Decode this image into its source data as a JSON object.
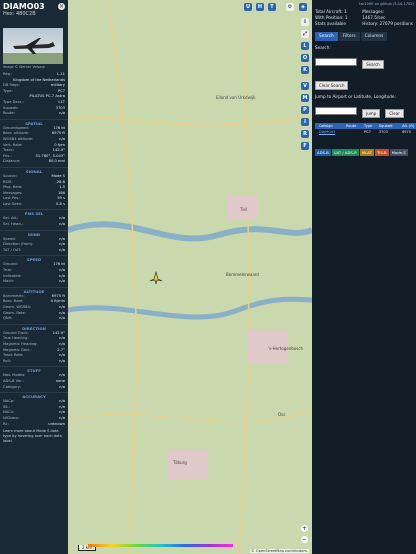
{
  "aircraft": {
    "callsign": "DIAMO03",
    "hex_line": "Hex: 480C2B",
    "image_credit": "Image © Werner Velsaqt",
    "details": [
      {
        "k": "Reg.:",
        "v": "L-11"
      },
      {
        "k": "",
        "v": "Kingdom of the Netherlands"
      },
      {
        "k": "DB flags:",
        "v": "military"
      },
      {
        "k": "Type:",
        "v": "PC7"
      },
      {
        "k": "",
        "v": "PILATUS PC-7 Astra"
      },
      {
        "k": "Type Desc.:",
        "v": "L1T"
      },
      {
        "k": "Squawk:",
        "v": "3703"
      },
      {
        "k": "Route:",
        "v": "n/a"
      }
    ],
    "sections": [
      {
        "title": "SPATIAL",
        "rows": [
          {
            "k": "Groundspeed:",
            "v": "176 kt"
          },
          {
            "k": "Baro. altitude:",
            "v": "6975 ft"
          },
          {
            "k": "WGS84 altitude:",
            "v": "n/a"
          },
          {
            "k": "Vert. Rate:",
            "v": "0 fpm"
          },
          {
            "k": "Track:",
            "v": "142.0°"
          },
          {
            "k": "Pos.:",
            "v": "51.780°, 5.043°"
          },
          {
            "k": "Distance:",
            "v": "80.0 nmi"
          }
        ]
      },
      {
        "title": "SIGNAL",
        "rows": [
          {
            "k": "Source:",
            "v": "Mode S"
          },
          {
            "k": "RSSI:",
            "v": "-28.6"
          },
          {
            "k": "Msg. Rate:",
            "v": "1.5"
          },
          {
            "k": "Messages:",
            "v": "186"
          },
          {
            "k": "Last Pos.:",
            "v": "59 s"
          },
          {
            "k": "Last Seen:",
            "v": "0.8 s"
          }
        ]
      },
      {
        "title": "FMS SEL",
        "rows": [
          {
            "k": "Sel. Alt.:",
            "v": "n/a"
          },
          {
            "k": "Sel. Head.:",
            "v": "n/a"
          }
        ]
      },
      {
        "title": "WIND",
        "rows": [
          {
            "k": "Speed:",
            "v": "n/a"
          },
          {
            "k": "Direction (from):",
            "v": "n/a"
          },
          {
            "k": "TAT / OAT:",
            "v": "n/a"
          }
        ]
      },
      {
        "title": "SPEED",
        "rows": [
          {
            "k": "Ground:",
            "v": "176 kt"
          },
          {
            "k": "True:",
            "v": "n/a"
          },
          {
            "k": "Indicated:",
            "v": "n/a"
          },
          {
            "k": "Mach:",
            "v": "n/a"
          }
        ]
      },
      {
        "title": "ALTITUDE",
        "rows": [
          {
            "k": "Barometric:",
            "v": "6975 ft"
          },
          {
            "k": "Baro. Rate:",
            "v": "0 ft/min"
          },
          {
            "k": "Geom. WGS84:",
            "v": "n/a"
          },
          {
            "k": "Geom. Rate:",
            "v": "n/a"
          },
          {
            "k": "QNH:",
            "v": "n/a"
          }
        ]
      },
      {
        "title": "DIRECTION",
        "rows": [
          {
            "k": "Ground Track:",
            "v": "142.0°"
          },
          {
            "k": "True Heading:",
            "v": "n/a"
          },
          {
            "k": "Magnetic Heading:",
            "v": "n/a"
          },
          {
            "k": "Magnetic Decl.:",
            "v": "2.7°"
          },
          {
            "k": "Track Rate:",
            "v": "n/a"
          },
          {
            "k": "Roll:",
            "v": "n/a"
          }
        ]
      },
      {
        "title": "STUFF",
        "rows": [
          {
            "k": "Nav. Modes:",
            "v": "n/a"
          },
          {
            "k": "ADS-B Ver.:",
            "v": "none"
          },
          {
            "k": "Category:",
            "v": "n/a"
          }
        ]
      },
      {
        "title": "ACCURACY",
        "rows": [
          {
            "k": "NACp:",
            "v": "n/a"
          },
          {
            "k": "SIL:",
            "v": "n/a"
          },
          {
            "k": "NACv:",
            "v": "n/a"
          },
          {
            "k": "NICbaro:",
            "v": "n/a"
          },
          {
            "k": "Rc:",
            "v": "unknown"
          }
        ]
      }
    ],
    "learn_more": "Learn more about Mode S data type by hovering over each data label."
  },
  "map": {
    "top_buttons": [
      "U",
      "H",
      "T"
    ],
    "side_buttons": [
      "L",
      "O",
      "K",
      "V",
      "M",
      "P",
      "I",
      "R",
      "F"
    ],
    "places": [
      {
        "label": "Eiland van Urkdwijk"
      },
      {
        "label": "Tiel"
      },
      {
        "label": "Bommelerwaard"
      },
      {
        "label": "'s-Hertogenbosch"
      },
      {
        "label": "Tilburg"
      },
      {
        "label": "Oss"
      }
    ],
    "scale": "2 km",
    "attribution": "© OpenStreetMap contributors.",
    "zoom_in": "+",
    "zoom_out": "−"
  },
  "right": {
    "version_link": "tar1090 on github (3.14.1702)",
    "total_label": "Total Aircraft: 1",
    "messages_label": "Messages:",
    "messages_value": "1467.5/sec",
    "position_label": "With Position: 1",
    "history_label": "History: 27079 positions",
    "stats_label": "Stats available",
    "tabs": [
      "Search",
      "Filters",
      "Columns"
    ],
    "search_label": "Search:",
    "search_button": "Search",
    "clear_button": "Clear Search",
    "jump_label": "Jump to Airport or Latitude, Longitude:",
    "jump_button": "Jump",
    "clear2_button": "Clear",
    "table": {
      "headers": [
        "",
        "Callsign",
        "Route",
        "Type",
        "Squawk",
        "Alt. (ft)",
        "Spd"
      ],
      "row": [
        "",
        "DIAMO03",
        "",
        "PC7",
        "3703",
        "6975",
        "176"
      ]
    },
    "badges": [
      {
        "label": "ADS-B",
        "color": "#1e5f9a"
      },
      {
        "label": "UAT / ADS-R",
        "color": "#1d8a55"
      },
      {
        "label": "MLAT",
        "color": "#b07a12"
      },
      {
        "label": "TIS-B",
        "color": "#c24d24"
      },
      {
        "label": "Mode-S",
        "color": "#3f4f60"
      }
    ]
  }
}
